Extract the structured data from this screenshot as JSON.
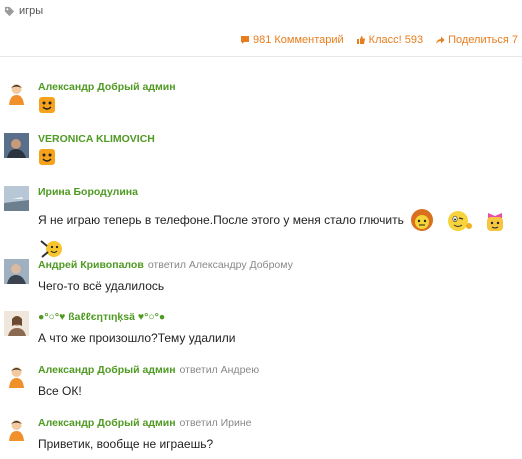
{
  "topic": {
    "tag_label": "игры"
  },
  "actions": {
    "comments_label": "981 Комментарий",
    "likes_label": "Класс! 593",
    "share_label": "Поделиться 7",
    "accent_color": "#e87d1e"
  },
  "comments": [
    {
      "author": "Александр Добрый админ",
      "reply_to": "",
      "text": ""
    },
    {
      "author": "VERONICA KLIMOVICH",
      "reply_to": "",
      "text": ""
    },
    {
      "author": "Ирина Бородулина",
      "reply_to": "",
      "text": "Я не играю теперь в телефоне.После этого у меня стало глючить"
    },
    {
      "author": "Андрей Кривопалов",
      "reply_to": "ответил Александру Доброму",
      "text": "Чего-то всё удалилось"
    },
    {
      "author": "●°○°♥ ßаℓℓєηтιηķѕä ♥°○°●",
      "reply_to": "",
      "text": "А что же произошло?Тему удалили"
    },
    {
      "author": "Александр Добрый админ",
      "reply_to": "ответил Андрею",
      "text": "Все ОК!"
    },
    {
      "author": "Александр Добрый админ",
      "reply_to": "ответил Ирине",
      "text": "Приветик, вообще не играешь?"
    }
  ],
  "colors": {
    "author_green": "#4f9a23",
    "muted": "#888888"
  }
}
